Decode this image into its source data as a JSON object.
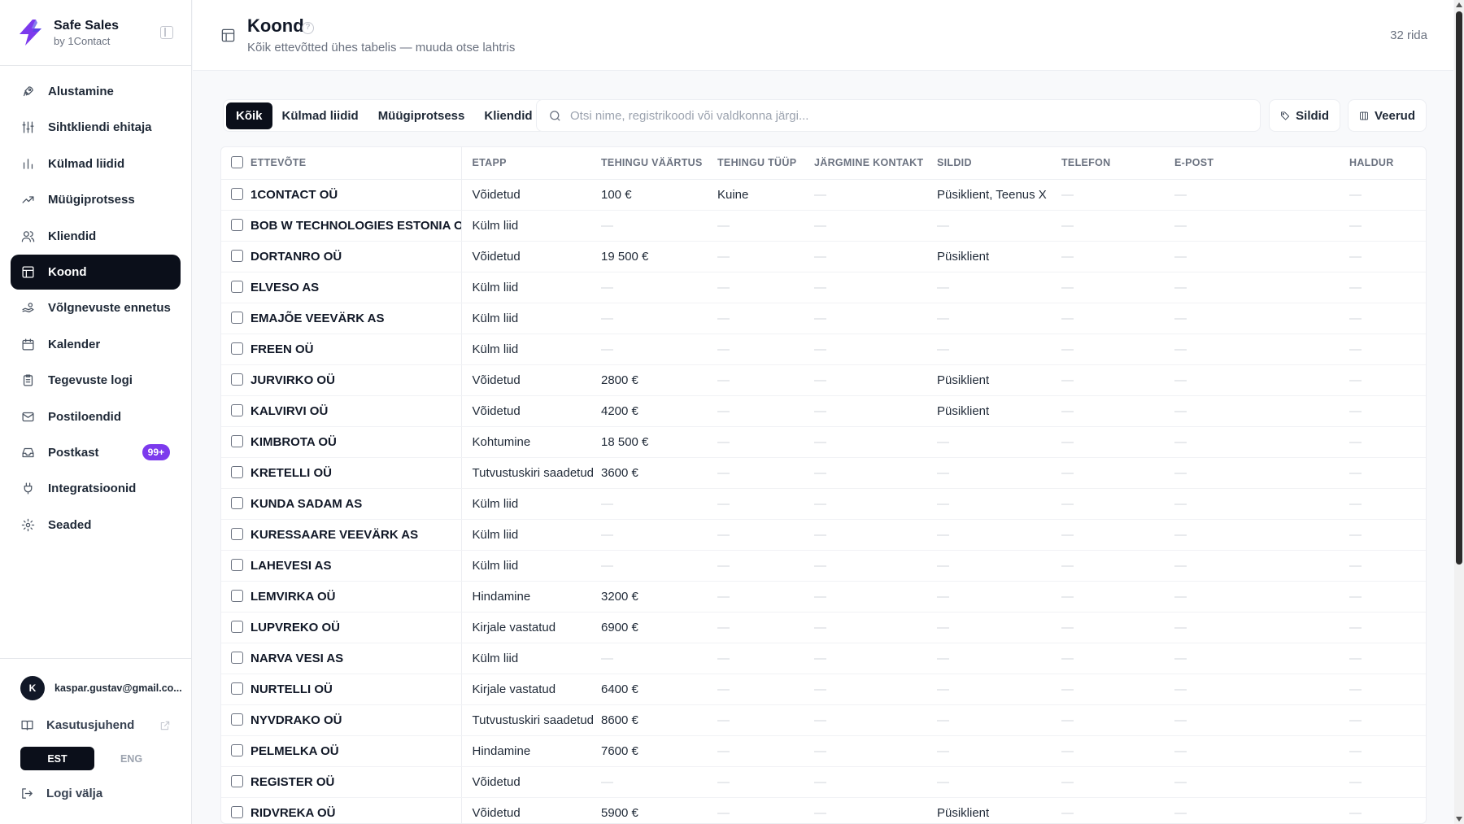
{
  "brand": {
    "name": "Safe Sales",
    "sub": "by 1Contact",
    "accent": "#7c3aed"
  },
  "sidebar": {
    "items": [
      {
        "label": "Alustamine",
        "icon": "rocket-icon",
        "active": false
      },
      {
        "label": "Sihtkliendi ehitaja",
        "icon": "sliders-icon",
        "active": false
      },
      {
        "label": "Külmad liidid",
        "icon": "bar-chart-icon",
        "active": false
      },
      {
        "label": "Müügiprotsess",
        "icon": "trending-up-icon",
        "active": false
      },
      {
        "label": "Kliendid",
        "icon": "users-icon",
        "active": false
      },
      {
        "label": "Koond",
        "icon": "table-icon",
        "active": true
      },
      {
        "label": "Võlgnevuste ennetus",
        "icon": "hand-coins-icon",
        "active": false
      },
      {
        "label": "Kalender",
        "icon": "calendar-icon",
        "active": false
      },
      {
        "label": "Tegevuste logi",
        "icon": "clipboard-icon",
        "active": false
      },
      {
        "label": "Postiloendid",
        "icon": "mail-icon",
        "active": false
      },
      {
        "label": "Postkast",
        "icon": "inbox-icon",
        "active": false,
        "badge": "99+"
      },
      {
        "label": "Integratsioonid",
        "icon": "plug-icon",
        "active": false
      },
      {
        "label": "Seaded",
        "icon": "gear-icon",
        "active": false
      }
    ],
    "user": {
      "initial": "K",
      "email": "kaspar.gustav@gmail.co..."
    },
    "guide_label": "Kasutusjuhend",
    "lang": {
      "est": "EST",
      "eng": "ENG",
      "selected": "EST"
    },
    "logout_label": "Logi välja"
  },
  "header": {
    "title": "Koond",
    "subtitle": "Kõik ettevõtted ühes tabelis — muuda otse lahtris",
    "row_count": "32 rida"
  },
  "toolbar": {
    "tabs": [
      "Kõik",
      "Külmad liidid",
      "Müügiprotsess",
      "Kliendid"
    ],
    "active_tab": "Kõik",
    "search_placeholder": "Otsi nime, registrikoodi või valdkonna järgi...",
    "tags_label": "Sildid",
    "columns_label": "Veerud"
  },
  "table": {
    "columns": [
      "ETTEVÕTE",
      "ETAPP",
      "TEHINGU VÄÄRTUS",
      "TEHINGU TÜÜP",
      "JÄRGMINE KONTAKT",
      "SILDID",
      "TELEFON",
      "E-POST",
      "HALDUR"
    ],
    "rows": [
      [
        "1CONTACT OÜ",
        "Võidetud",
        "100 €",
        "Kuine",
        "—",
        "Püsiklient, Teenus X",
        "—",
        "—",
        "—"
      ],
      [
        "BOB W TECHNOLOGIES ESTONIA OÜ",
        "Külm liid",
        "—",
        "—",
        "—",
        "—",
        "—",
        "—",
        "—"
      ],
      [
        "DORTANRO OÜ",
        "Võidetud",
        "19 500 €",
        "—",
        "—",
        "Püsiklient",
        "—",
        "—",
        "—"
      ],
      [
        "ELVESO AS",
        "Külm liid",
        "—",
        "—",
        "—",
        "—",
        "—",
        "—",
        "—"
      ],
      [
        "EMAJÕE VEEVÄRK AS",
        "Külm liid",
        "—",
        "—",
        "—",
        "—",
        "—",
        "—",
        "—"
      ],
      [
        "FREEN OÜ",
        "Külm liid",
        "—",
        "—",
        "—",
        "—",
        "—",
        "—",
        "—"
      ],
      [
        "JURVIRKO OÜ",
        "Võidetud",
        "2800 €",
        "—",
        "—",
        "Püsiklient",
        "—",
        "—",
        "—"
      ],
      [
        "KALVIRVI OÜ",
        "Võidetud",
        "4200 €",
        "—",
        "—",
        "Püsiklient",
        "—",
        "—",
        "—"
      ],
      [
        "KIMBROTA OÜ",
        "Kohtumine",
        "18 500 €",
        "—",
        "—",
        "—",
        "—",
        "—",
        "—"
      ],
      [
        "KRETELLI OÜ",
        "Tutvustuskiri saadetud",
        "3600 €",
        "—",
        "—",
        "—",
        "—",
        "—",
        "—"
      ],
      [
        "KUNDA SADAM AS",
        "Külm liid",
        "—",
        "—",
        "—",
        "—",
        "—",
        "—",
        "—"
      ],
      [
        "KURESSAARE VEEVÄRK AS",
        "Külm liid",
        "—",
        "—",
        "—",
        "—",
        "—",
        "—",
        "—"
      ],
      [
        "LAHEVESI AS",
        "Külm liid",
        "—",
        "—",
        "—",
        "—",
        "—",
        "—",
        "—"
      ],
      [
        "LEMVIRKA OÜ",
        "Hindamine",
        "3200 €",
        "—",
        "—",
        "—",
        "—",
        "—",
        "—"
      ],
      [
        "LUPVREKO OÜ",
        "Kirjale vastatud",
        "6900 €",
        "—",
        "—",
        "—",
        "—",
        "—",
        "—"
      ],
      [
        "NARVA VESI AS",
        "Külm liid",
        "—",
        "—",
        "—",
        "—",
        "—",
        "—",
        "—"
      ],
      [
        "NURTELLI OÜ",
        "Kirjale vastatud",
        "6400 €",
        "—",
        "—",
        "—",
        "—",
        "—",
        "—"
      ],
      [
        "NYVDRAKO OÜ",
        "Tutvustuskiri saadetud",
        "8600 €",
        "—",
        "—",
        "—",
        "—",
        "—",
        "—"
      ],
      [
        "PELMELKA OÜ",
        "Hindamine",
        "7600 €",
        "—",
        "—",
        "—",
        "—",
        "—",
        "—"
      ],
      [
        "REGISTER OÜ",
        "Võidetud",
        "—",
        "—",
        "—",
        "—",
        "—",
        "—",
        "—"
      ],
      [
        "RIDVREKA OÜ",
        "Võidetud",
        "5900 €",
        "—",
        "—",
        "Püsiklient",
        "—",
        "—",
        "—"
      ]
    ]
  }
}
